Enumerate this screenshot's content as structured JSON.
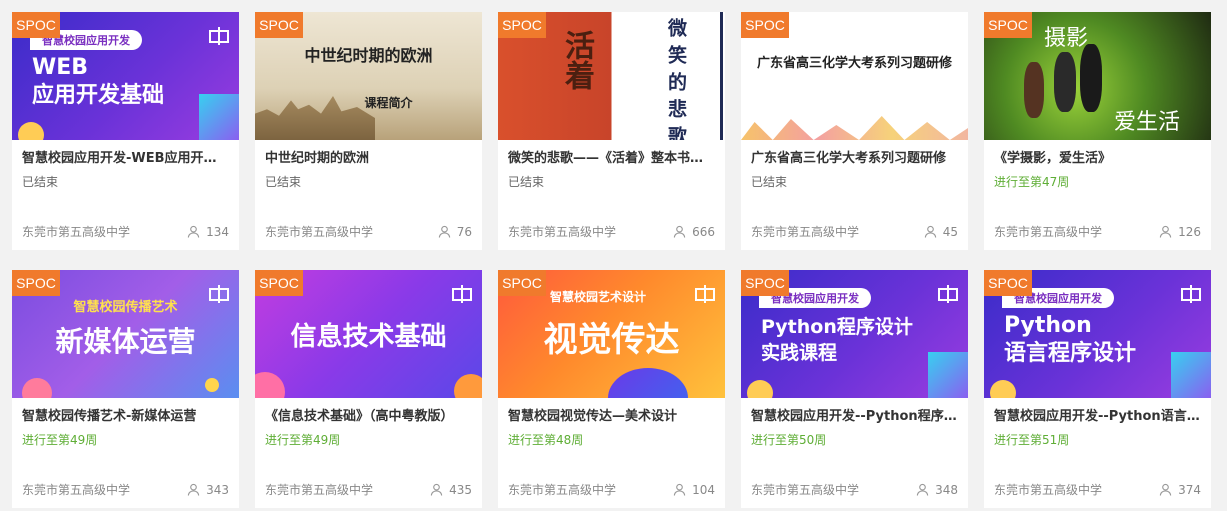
{
  "badge": "SPOC",
  "courses": [
    {
      "cover_title": "WEB\n应用开发基础",
      "cover_sub": "智慧校园应用开发",
      "title": "智慧校园应用开发-WEB应用开发基础",
      "status": "已结束",
      "school": "东莞市第五高级中学",
      "count": "134"
    },
    {
      "cover_title": "中世纪时期的欧洲",
      "cover_sub": "课程简介",
      "title": "中世纪时期的欧洲",
      "status": "已结束",
      "school": "东莞市第五高级中学",
      "count": "76"
    },
    {
      "cover_title": "活着",
      "cover_sub": "微笑的悲歌",
      "title": "微笑的悲歌——《活着》整本书阅读",
      "status": "已结束",
      "school": "东莞市第五高级中学",
      "count": "666"
    },
    {
      "cover_title": "广东省高三化学大考系列习题研修",
      "cover_sub": "",
      "title": "广东省高三化学大考系列习题研修",
      "status": "已结束",
      "school": "东莞市第五高级中学",
      "count": "45"
    },
    {
      "cover_title": "摄影",
      "cover_sub": "爱生活",
      "title": "《学摄影，爱生活》",
      "status": "进行至第47周",
      "school": "东莞市第五高级中学",
      "count": "126"
    },
    {
      "cover_title": "新媒体运营",
      "cover_sub": "智慧校园传播艺术",
      "title": "智慧校园传播艺术-新媒体运营",
      "status": "进行至第49周",
      "school": "东莞市第五高级中学",
      "count": "343"
    },
    {
      "cover_title": "信息技术基础",
      "cover_sub": "",
      "title": "《信息技术基础》（高中粤教版）",
      "status": "进行至第49周",
      "school": "东莞市第五高级中学",
      "count": "435"
    },
    {
      "cover_title": "视觉传达",
      "cover_sub": "智慧校园艺术设计",
      "title": "智慧校园视觉传达—美术设计",
      "status": "进行至第48周",
      "school": "东莞市第五高级中学",
      "count": "104"
    },
    {
      "cover_title": "Python程序设计\n实践课程",
      "cover_sub": "智慧校园应用开发",
      "title": "智慧校园应用开发--Python程序设计实践课程",
      "status": "进行至第50周",
      "school": "东莞市第五高级中学",
      "count": "348"
    },
    {
      "cover_title": "Python\n语言程序设计",
      "cover_sub": "智慧校园应用开发",
      "title": "智慧校园应用开发--Python语言程序设计",
      "status": "进行至第51周",
      "school": "东莞市第五高级中学",
      "count": "374"
    }
  ]
}
